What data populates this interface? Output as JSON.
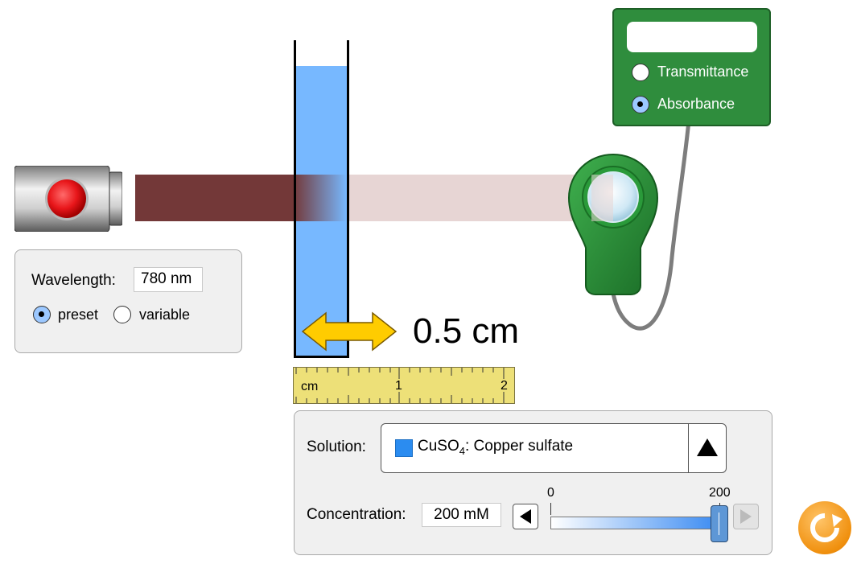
{
  "light_source": {
    "button_color": "#e8161a"
  },
  "path_length": {
    "value": "0.5 cm"
  },
  "ruler": {
    "unit": "cm",
    "tick_labels": [
      "1",
      "2"
    ]
  },
  "wavelength_panel": {
    "label": "Wavelength:",
    "value": "780 nm",
    "options": [
      {
        "label": "preset",
        "selected": true
      },
      {
        "label": "variable",
        "selected": false
      }
    ]
  },
  "detector": {
    "display_value": "",
    "modes": [
      {
        "label": "Transmittance",
        "selected": false
      },
      {
        "label": "Absorbance",
        "selected": true
      }
    ]
  },
  "solution_panel": {
    "solution_label": "Solution:",
    "solution_formula_main": "CuSO",
    "solution_formula_sub": "4",
    "solution_name": ": Copper sulfate",
    "solution_color": "#2b8cf0",
    "concentration_label": "Concentration:",
    "concentration_value": "200 mM",
    "slider_min": "0",
    "slider_max": "200",
    "slider_fraction": 1.0
  },
  "colors": {
    "beam": "#733838",
    "liquid": "#77b8ff",
    "meter": "#2f8d3d",
    "reset": "#f0900e"
  }
}
